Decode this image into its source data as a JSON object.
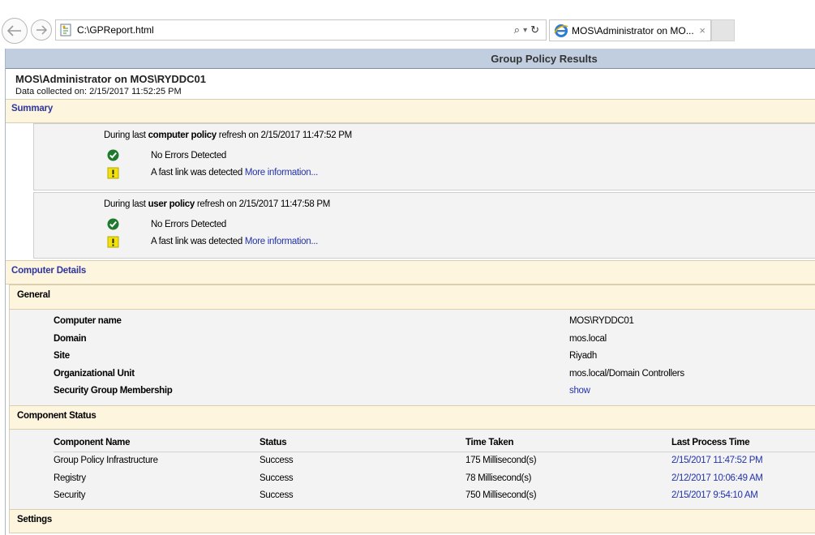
{
  "browser": {
    "address": "C:\\GPReport.html",
    "tab_title": "MOS\\Administrator on MO...",
    "tab_close": "×",
    "search_glyph": "⌕",
    "dropdown_glyph": "▾",
    "refresh_glyph": "↻"
  },
  "report": {
    "title": "Group Policy Results",
    "heading": "MOS\\Administrator on MOS\\RYDDC01",
    "data_collected": "Data collected on: 2/15/2017 11:52:25 PM"
  },
  "summary": {
    "label": "Summary",
    "computer": {
      "prefix": "During last ",
      "bold": "computer policy",
      "suffix": " refresh on 2/15/2017 11:47:52 PM",
      "status_ok": "No Errors Detected",
      "status_warn": "A fast link was detected ",
      "more_info": "More information..."
    },
    "user": {
      "prefix": "During last ",
      "bold": "user policy",
      "suffix": " refresh on 2/15/2017 11:47:58 PM",
      "status_ok": "No Errors Detected",
      "status_warn": "A fast link was detected ",
      "more_info": "More information..."
    }
  },
  "computer_details": {
    "label": "Computer Details",
    "general": {
      "label": "General",
      "rows": [
        {
          "key": "Computer name",
          "value": "MOS\\RYDDC01"
        },
        {
          "key": "Domain",
          "value": "mos.local"
        },
        {
          "key": "Site",
          "value": "Riyadh"
        },
        {
          "key": "Organizational Unit",
          "value": "mos.local/Domain Controllers"
        },
        {
          "key": "Security Group Membership",
          "value": "show"
        }
      ]
    },
    "component_status": {
      "label": "Component Status",
      "headers": [
        "Component Name",
        "Status",
        "Time Taken",
        "Last Process Time"
      ],
      "rows": [
        [
          "Group Policy Infrastructure",
          "Success",
          "175 Millisecond(s)",
          "2/15/2017 11:47:52 PM"
        ],
        [
          "Registry",
          "Success",
          "78 Millisecond(s)",
          "2/12/2017 10:06:49 AM"
        ],
        [
          "Security",
          "Success",
          "750 Millisecond(s)",
          "2/15/2017 9:54:10 AM"
        ]
      ]
    },
    "settings": {
      "label": "Settings"
    }
  },
  "colors": {
    "title_bar": "#c0cedf",
    "section_bar": "#fdf5dd",
    "link": "#2233aa",
    "ok": "#1f7a2e",
    "warn": "#f2e20a"
  }
}
